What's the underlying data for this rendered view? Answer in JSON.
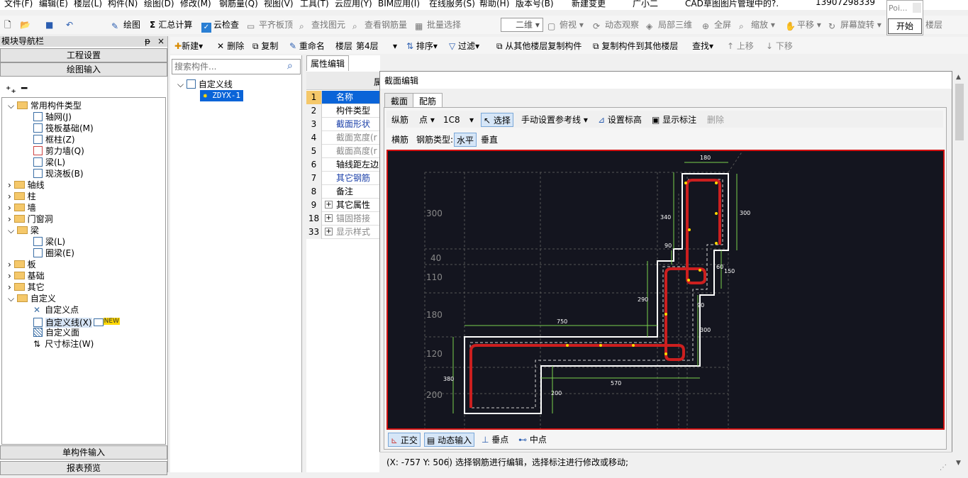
{
  "menu": {
    "items": [
      "文件(F)",
      "编辑(E)",
      "楼层(L)",
      "构件(N)",
      "绘图(D)",
      "修改(M)",
      "钢筋量(Q)",
      "视图(V)",
      "工具(T)",
      "云应用(Y)",
      "BIM应用(I)",
      "在线服务(S)",
      "帮助(H)",
      "版本号(B)"
    ],
    "new_change": "新建变更",
    "user_name": "广小二",
    "cad_status": "CAD草图图片管理中的?.",
    "phone": "13907298339"
  },
  "toolbar1": {
    "draw": "绘图",
    "calc": "汇总计算",
    "cloud_check": "云检查",
    "level_slab": "平齐板顶",
    "find_elem": "查找图元",
    "view_rebar": "查看钢筋量",
    "batch_select": "批量选择",
    "view_mode": "二维",
    "top_view": "俯视",
    "dynamic_view": "动态观察",
    "local_3d": "局部三维",
    "fullscreen": "全屏",
    "zoom": "缩放",
    "pan": "平移",
    "screen_rotate": "屏幕旋转",
    "floor": "楼层"
  },
  "popup": {
    "input_text": "Poi...",
    "start_button": "开始"
  },
  "nav": {
    "title": "模块导航栏",
    "pin": "ᵽ",
    "close": "×",
    "project_settings": "工程设置",
    "drawing_input": "绘图输入",
    "single_input": "单构件输入",
    "report_preview": "报表预览",
    "tree": {
      "common_types": "常用构件类型",
      "common_children": [
        "轴网(J)",
        "筏板基础(M)",
        "框柱(Z)",
        "剪力墙(Q)",
        "梁(L)",
        "现浇板(B)"
      ],
      "axis": "轴线",
      "column": "柱",
      "wall": "墙",
      "doors": "门窗洞",
      "beam": "梁",
      "beam_children": [
        "梁(L)",
        "圈梁(E)"
      ],
      "slab": "板",
      "foundation": "基础",
      "other": "其它",
      "custom": "自定义",
      "custom_children": [
        "自定义点",
        "自定义线(X)",
        "自定义面",
        "尺寸标注(W)"
      ],
      "new_badge": "NEW"
    }
  },
  "component_toolbar": {
    "new": "新建",
    "delete": "删除",
    "copy": "复制",
    "rename": "重命名",
    "floor_label": "楼层",
    "floor_value": "第4层",
    "sort": "排序",
    "filter": "过滤",
    "copy_from_floor": "从其他楼层复制构件",
    "copy_to_floor": "复制构件到其他楼层",
    "find": "查找",
    "move_up": "上移",
    "move_down": "下移"
  },
  "component_list": {
    "search_placeholder": "搜索构件...",
    "root": "自定义线",
    "selected": "ZDYX-1"
  },
  "property_panel": {
    "tab": "属性编辑",
    "col_header": "属",
    "rows": [
      {
        "num": "1",
        "label": "名称"
      },
      {
        "num": "2",
        "label": "构件类型"
      },
      {
        "num": "3",
        "label": "截面形状"
      },
      {
        "num": "4",
        "label": "截面宽度(r"
      },
      {
        "num": "5",
        "label": "截面高度(r"
      },
      {
        "num": "6",
        "label": "轴线距左边"
      },
      {
        "num": "7",
        "label": "其它钢筋"
      },
      {
        "num": "8",
        "label": "备注"
      },
      {
        "num": "9",
        "label": "其它属性"
      },
      {
        "num": "18",
        "label": "锚固搭接"
      },
      {
        "num": "33",
        "label": "显示样式"
      }
    ]
  },
  "dialog": {
    "title": "截面编辑",
    "tabs": [
      "截面",
      "配筋"
    ],
    "toolbar": {
      "longitudinal": "纵筋",
      "point": "点",
      "rebar_spec": "1C8",
      "select": "选择",
      "manual_ref": "手动设置参考线",
      "set_elevation": "设置标高",
      "show_annotation": "显示标注",
      "delete": "删除"
    },
    "toolbar2": {
      "transverse": "横筋",
      "rebar_type_label": "钢筋类型:",
      "horizontal": "水平",
      "vertical": "垂直"
    },
    "canvas_labels": {
      "d180": "180",
      "d340": "340",
      "d300a": "300",
      "d90a": "90",
      "d150": "150",
      "d60": "60",
      "d290": "290",
      "d90b": "90",
      "d750": "750",
      "d300b": "300",
      "d380": "380",
      "d570": "570",
      "d200": "200",
      "grid_300": "300",
      "grid_40": "40",
      "grid_110": "110",
      "grid_180": "180",
      "grid_120": "120",
      "grid_200": "200"
    },
    "bottom": {
      "ortho": "正交",
      "dynamic_input": "动态输入",
      "perpendicular": "垂点",
      "midpoint": "中点"
    },
    "status": {
      "coords": "(X: -757 Y: 506)",
      "message": "选择钢筋进行编辑，选择标注进行修改或移动;"
    }
  },
  "colors": {
    "accent": "#0a5fb4",
    "canvas_bg": "#14151f",
    "rebar": "#cc1f1f",
    "dimension": "#7ad14c",
    "selection_bg": "#0a64d8"
  }
}
